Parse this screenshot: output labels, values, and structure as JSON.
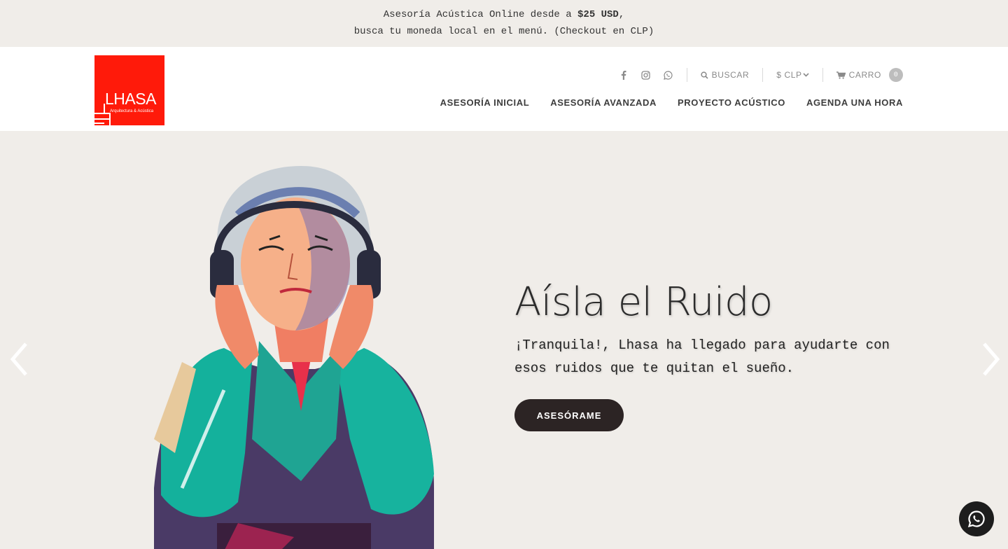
{
  "announcement": {
    "line1_prefix": "Asesoría Acústica Online desde a ",
    "line1_bold": "$25 USD",
    "line1_suffix": ",",
    "line2": "busca tu moneda local en el menú. (Checkout en CLP)"
  },
  "logo": {
    "name": "LHASA",
    "tagline": "Arquitectura & Acústica",
    "color": "#ff1a0a"
  },
  "utility": {
    "social_icons": [
      "facebook-icon",
      "instagram-icon",
      "whatsapp-icon"
    ],
    "search_label": "BUSCAR",
    "currency_label": "$ CLP",
    "cart_label": "CARRO",
    "cart_count": "0"
  },
  "nav": {
    "items": [
      {
        "label": "ASESORÍA INICIAL"
      },
      {
        "label": "ASESORÍA AVANZADA"
      },
      {
        "label": "PROYECTO ACÚSTICO"
      },
      {
        "label": "AGENDA UNA HORA"
      }
    ]
  },
  "hero": {
    "title": "Aísla el Ruido",
    "subtitle": "¡Tranquila!, Lhasa ha llegado para ayudarte con esos ruidos que te quitan el sueño.",
    "cta_label": "ASESÓRAME",
    "cta_color": "#2c2424"
  },
  "colors": {
    "background": "#f0ede9",
    "header": "#ffffff",
    "accent": "#ff1a0a"
  }
}
